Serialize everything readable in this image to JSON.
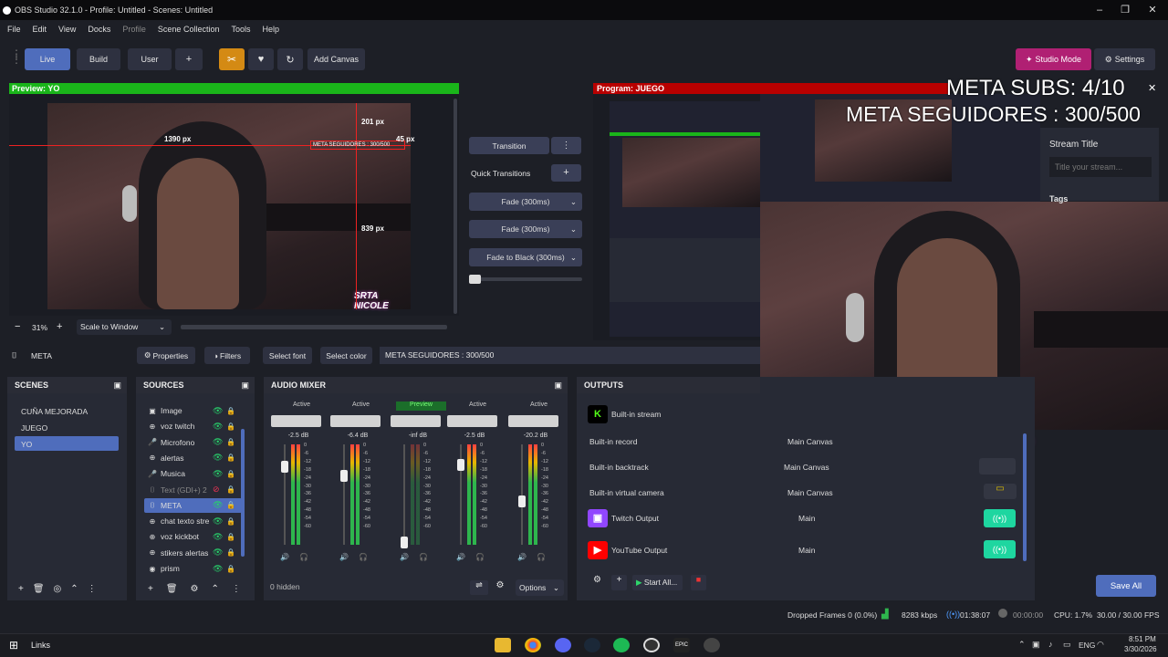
{
  "window": {
    "title": "OBS Studio 32.1.0 - Profile: Untitled - Scenes: Untitled"
  },
  "menu": [
    "File",
    "Edit",
    "View",
    "Docks",
    "Profile",
    "Scene Collection",
    "Tools",
    "Help"
  ],
  "toolbar": {
    "live": "Live",
    "build": "Build",
    "user": "User",
    "add": "+",
    "add_canvas": "Add Canvas",
    "studio_mode": "Studio Mode",
    "settings": "Settings"
  },
  "preview": {
    "label": "Preview: YO",
    "w_px": "1390 px",
    "h_top": "201 px",
    "right": "45 px",
    "bottom": "839 px",
    "text_source": "META SEGUIDORES : 300/500",
    "zoom": "31%",
    "scale_mode": "Scale to Window"
  },
  "program": {
    "label": "Program: JUEGO"
  },
  "transition": {
    "button": "Transition",
    "quick": "Quick Transitions",
    "fade1": "Fade (300ms)",
    "fade2": "Fade (300ms)",
    "fade_black": "Fade to Black (300ms)"
  },
  "context": {
    "source": "META",
    "properties": "Properties",
    "filters": "Filters",
    "select_font": "Select font",
    "select_color": "Select color",
    "text": "META SEGUIDORES : 300/500"
  },
  "scenes": {
    "title": "SCENES",
    "items": [
      "CUÑA MEJORADA",
      "JUEGO",
      "YO"
    ]
  },
  "sources": {
    "title": "SOURCES",
    "items": [
      {
        "name": "Image",
        "icon": "image-icon"
      },
      {
        "name": "voz twitch",
        "icon": "globe-icon"
      },
      {
        "name": "Microfono",
        "icon": "mic-icon"
      },
      {
        "name": "alertas",
        "icon": "globe-icon"
      },
      {
        "name": "Musica",
        "icon": "mic-icon"
      },
      {
        "name": "Text (GDI+) 2",
        "icon": "text-icon"
      },
      {
        "name": "META",
        "icon": "text-icon"
      },
      {
        "name": "chat texto stre",
        "icon": "globe-icon"
      },
      {
        "name": "voz kickbot",
        "icon": "globe-icon"
      },
      {
        "name": "stikers alertas",
        "icon": "globe-icon"
      },
      {
        "name": "prism",
        "icon": "camera-icon"
      }
    ]
  },
  "mixer": {
    "title": "AUDIO MIXER",
    "hidden": "0 hidden",
    "options": "Options",
    "channels": [
      {
        "status": "Active",
        "db": "-2.5 dB"
      },
      {
        "status": "Active",
        "db": "-6.4 dB"
      },
      {
        "status": "Preview",
        "db": "-inf dB"
      },
      {
        "status": "Active",
        "db": "-2.5 dB"
      },
      {
        "status": "Active",
        "db": "-20.2 dB"
      }
    ],
    "scale": [
      "0",
      "-6",
      "-12",
      "-18",
      "-24",
      "-30",
      "-36",
      "-42",
      "-48",
      "-54",
      "-60"
    ]
  },
  "outputs": {
    "title": "OUTPUTS",
    "start_all": "Start All...",
    "rows": [
      {
        "name": "Built-in stream",
        "canvas": ""
      },
      {
        "name": "Built-in record",
        "canvas": "Main Canvas"
      },
      {
        "name": "Built-in backtrack",
        "canvas": "Main Canvas"
      },
      {
        "name": "Built-in virtual camera",
        "canvas": "Main Canvas"
      },
      {
        "name": "Twitch Output",
        "canvas": "Main"
      },
      {
        "name": "YouTube Output",
        "canvas": "Main"
      }
    ]
  },
  "stream_info": {
    "title": "Stream Title",
    "placeholder": "Title your stream...",
    "tags": "Tags",
    "save": "Save All"
  },
  "overlay": {
    "subs": "META SUBS: 4/10",
    "seguidores": "META SEGUIDORES : 300/500",
    "brand": "SRTA NICOLE"
  },
  "status": {
    "dropped": "Dropped Frames 0 (0.0%)",
    "kbps": "8283 kbps",
    "time1": "01:38:07",
    "time2": "00:00:00",
    "cpu": "CPU: 1.7%",
    "fps": "30.00 / 30.00 FPS"
  },
  "taskbar": {
    "links": "Links",
    "lang": "ENG",
    "time": "8:51 PM",
    "date": "3/30/2026"
  },
  "colors": {
    "accent": "#4f6dbc",
    "studio": "#b02073",
    "preview_green": "#1ab51a",
    "program_red": "#b80000",
    "toggle_green": "#1ed6a0"
  }
}
